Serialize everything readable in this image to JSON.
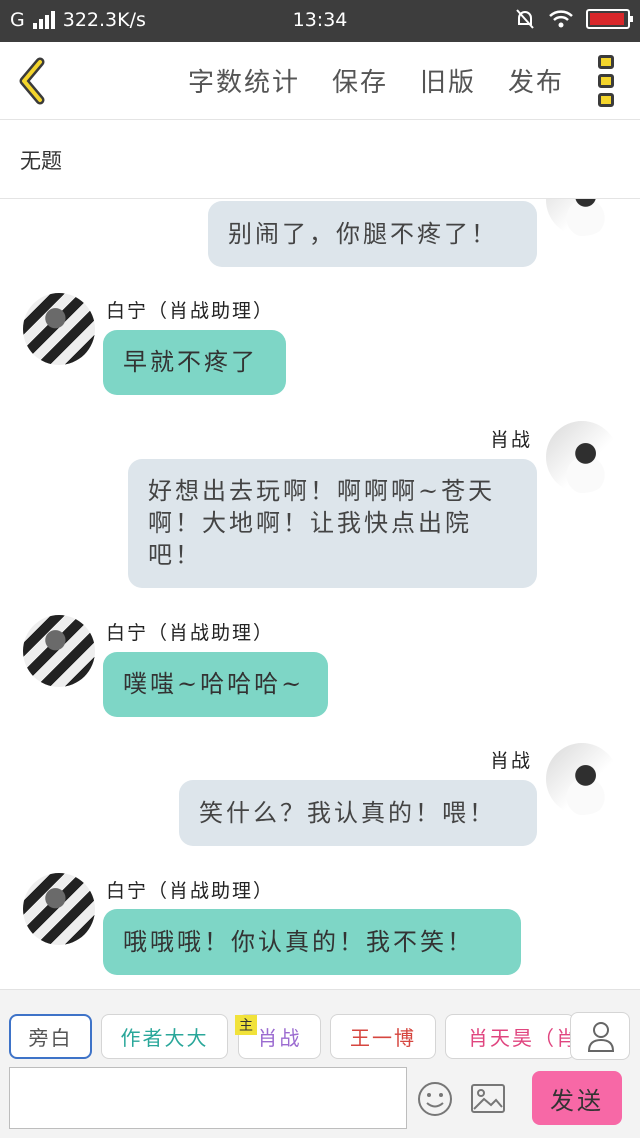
{
  "status_bar": {
    "network": "G",
    "speed": "322.3K/s",
    "time": "13:34",
    "battery_level": 0.95
  },
  "toolbar": {
    "word_count": "字数统计",
    "save": "保存",
    "old_version": "旧版",
    "publish": "发布"
  },
  "doc_title": "无题",
  "messages": [
    {
      "side": "right",
      "name": "",
      "text": "别闹了，你腿不疼了！"
    },
    {
      "side": "left",
      "name": "白宁（肖战助理）",
      "text": "早就不疼了"
    },
    {
      "side": "right",
      "name": "肖战",
      "line1": "好想出去玩啊！啊啊啊~苍天",
      "line2": "啊！大地啊！让我快点出院",
      "line3": "吧！"
    },
    {
      "side": "left",
      "name": "白宁（肖战助理）",
      "text": "噗嗤~哈哈哈~"
    },
    {
      "side": "right",
      "name": "肖战",
      "text": "笑什么？我认真的！喂！"
    },
    {
      "side": "left",
      "name": "白宁（肖战助理）",
      "text": "哦哦哦！你认真的！我不笑！"
    }
  ],
  "roles": [
    {
      "label": "旁白",
      "color": "#555555"
    },
    {
      "label": "作者大大",
      "color": "#2aa79a"
    },
    {
      "label": "肖战",
      "color": "#9b6bd0",
      "tag": "主"
    },
    {
      "label": "王一博",
      "color": "#d6463f"
    },
    {
      "label": "肖天昊（肖",
      "color": "#e0457f"
    }
  ],
  "send_label": "发送",
  "icons": [
    "back-chevron-icon",
    "more-menu-icon",
    "person-icon",
    "emoji-icon",
    "image-icon"
  ]
}
